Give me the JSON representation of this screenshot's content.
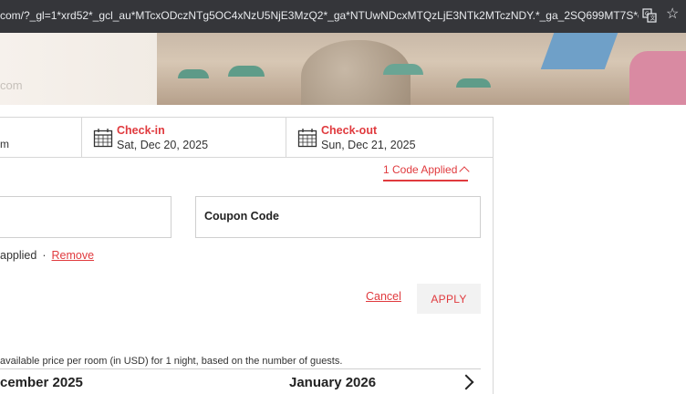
{
  "browser": {
    "url": "com/?_gl=1*xrd52*_gcl_au*MTcxODczNTg5OC4xNzU5NjE3MzQ2*_ga*NTUwNDcxMTQzLjE3NTk2MTczNDY.*_ga_2SQ699MT7S*czE3NTk2M..."
  },
  "hero": {
    "domain_text": "com"
  },
  "booking": {
    "prev_cell_value": "m",
    "check_in_label": "Check-in",
    "check_in_value": "Sat, Dec 20, 2025",
    "check_out_label": "Check-out",
    "check_out_value": "Sun, Dec 21, 2025",
    "code_applied_label": "1 Code Applied",
    "coupon_placeholder": "Coupon Code",
    "applied_text": "applied",
    "dot": "·",
    "remove_label": "Remove",
    "cancel_label": "Cancel",
    "apply_label": "APPLY",
    "price_note": "available price per room (in USD) for 1 night, based on the number of guests.",
    "month_left": "cember 2025",
    "month_right": "January 2026"
  },
  "colors": {
    "accent": "#e03a3e",
    "border": "#d7d7d7"
  }
}
